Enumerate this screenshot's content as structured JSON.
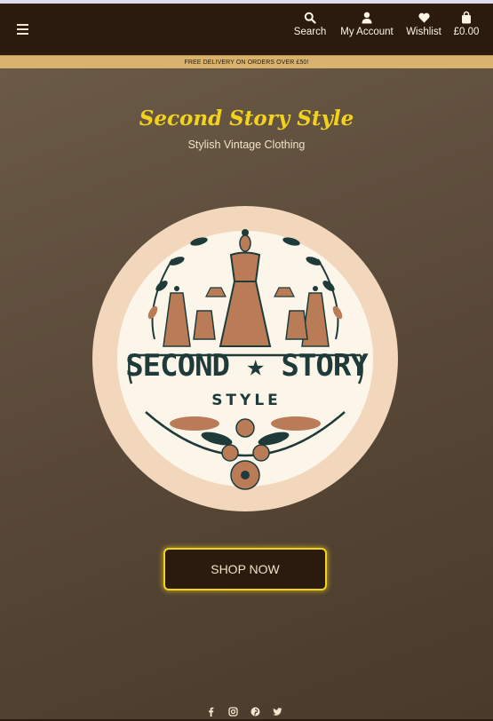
{
  "nav": {
    "menu_icon": "hamburger-icon",
    "items": [
      {
        "label": "Search",
        "icon": "search-icon"
      },
      {
        "label": "My Account",
        "icon": "user-icon"
      },
      {
        "label": "Wishlist",
        "icon": "heart-icon"
      },
      {
        "label": "£0.00",
        "icon": "shopping-bag-icon"
      }
    ]
  },
  "banner": {
    "text": "FREE DELIVERY ON ORDERS OVER £50!"
  },
  "hero": {
    "title": "Second Story Style",
    "subtitle": "Stylish Vintage Clothing",
    "logo": {
      "line1": "SECOND ★ STORY",
      "line2": "STYLE"
    },
    "cta": "SHOP NOW"
  },
  "footer": {
    "socials": [
      "facebook-icon",
      "instagram-icon",
      "pinterest-icon",
      "twitter-icon"
    ]
  },
  "colors": {
    "nav_bg": "#2a1b0e",
    "banner_bg": "#d9b36e",
    "accent_yellow": "#f2d21a",
    "logo_ring": "#f3d7bd",
    "logo_teal": "#1e3b3a",
    "logo_terracotta": "#b97c57"
  }
}
